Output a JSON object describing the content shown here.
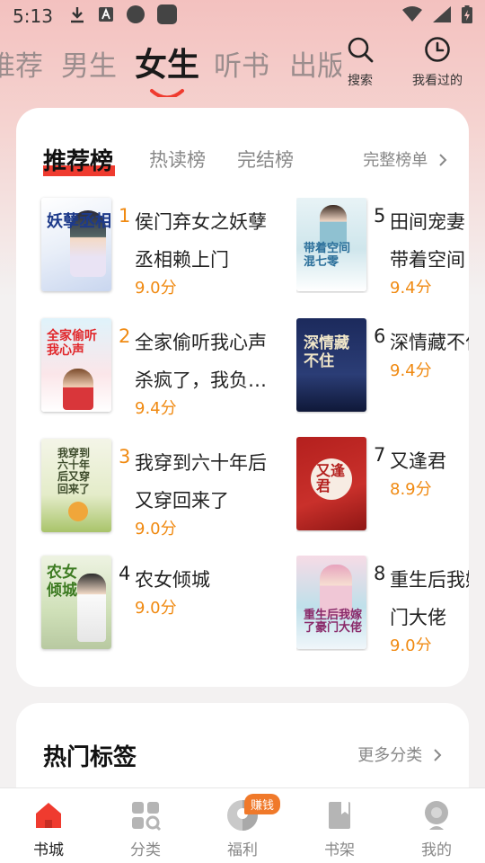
{
  "status_bar": {
    "time": "5:13"
  },
  "nav": {
    "tabs": [
      "推荐",
      "男生",
      "女生",
      "听书",
      "出版"
    ],
    "active_index": 2,
    "search_label": "搜索",
    "history_label": "我看过的"
  },
  "ranking": {
    "tabs": [
      "推荐榜",
      "热读榜",
      "完结榜"
    ],
    "active_index": 0,
    "more_label": "完整榜单",
    "books": [
      {
        "rank": "1",
        "title_line1": "侯门弃女之妖孽",
        "title_line2": "丞相赖上门",
        "score": "9.0分",
        "rank_color": "#f08a12",
        "cover_text": "妖孽丞相"
      },
      {
        "rank": "2",
        "title_line1": "全家偷听我心声",
        "title_line2": "杀疯了，我负…",
        "score": "9.4分",
        "rank_color": "#f08a12",
        "cover_text": "全家偷听我心声"
      },
      {
        "rank": "3",
        "title_line1": "我穿到六十年后",
        "title_line2": "又穿回来了",
        "score": "9.0分",
        "rank_color": "#f08a12",
        "cover_text": "我穿到六十年后又穿回来了"
      },
      {
        "rank": "4",
        "title_line1": "农女倾城",
        "title_line2": "",
        "score": "9.0分",
        "rank_color": "#222222",
        "cover_text": "农女倾城"
      },
      {
        "rank": "5",
        "title_line1": "田间宠妻",
        "title_line2": "带着空间",
        "score": "9.4分",
        "rank_color": "#222222",
        "cover_text": "带着空间混七零"
      },
      {
        "rank": "6",
        "title_line1": "深情藏不住",
        "title_line2": "",
        "score": "9.4分",
        "rank_color": "#222222",
        "cover_text": "深情藏不住"
      },
      {
        "rank": "7",
        "title_line1": "又逢君",
        "title_line2": "",
        "score": "8.9分",
        "rank_color": "#222222",
        "cover_text": "又逢君"
      },
      {
        "rank": "8",
        "title_line1": "重生后我嫁",
        "title_line2": "门大佬",
        "score": "9.0分",
        "rank_color": "#222222",
        "cover_text": "重生后我嫁了豪门大佬"
      }
    ]
  },
  "tags": {
    "title": "热门标签",
    "more_label": "更多分类"
  },
  "bottom_nav": {
    "items": [
      "书城",
      "分类",
      "福利",
      "书架",
      "我的"
    ],
    "active_index": 0,
    "badge": "赚钱"
  },
  "colors": {
    "accent": "#ef3b2f",
    "score": "#f08a12"
  }
}
